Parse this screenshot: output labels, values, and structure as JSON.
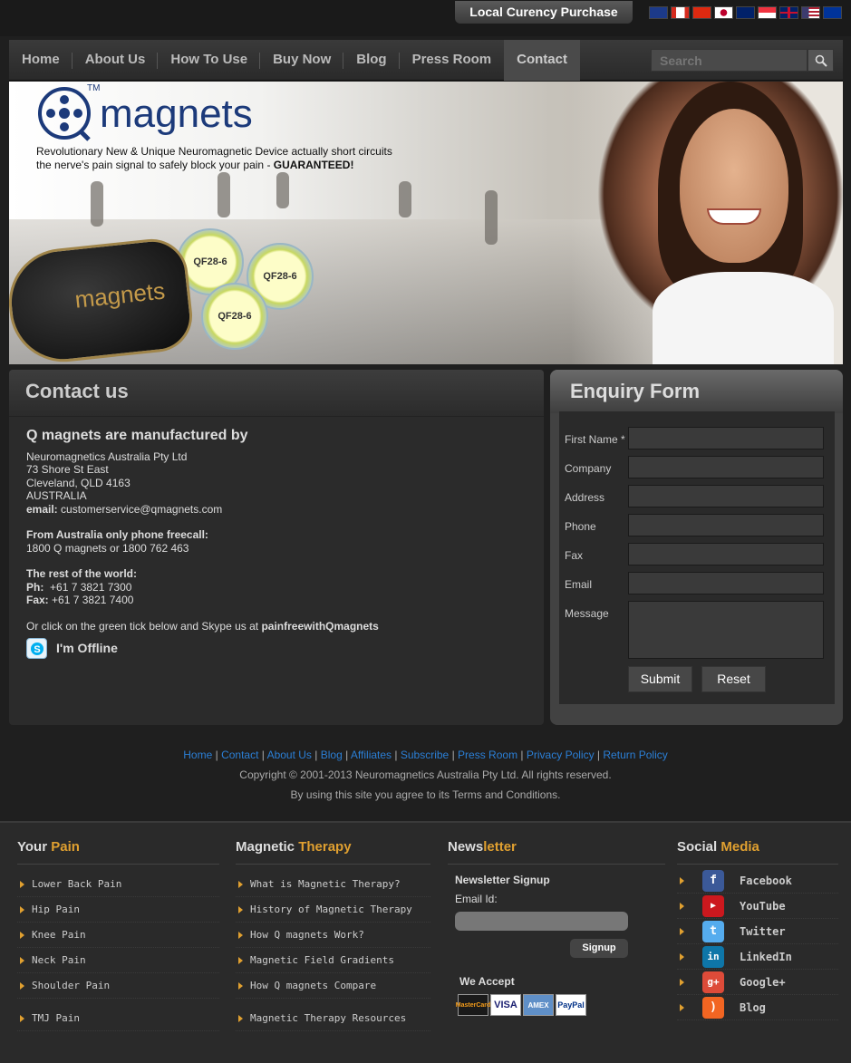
{
  "topbar": {
    "currency_label": "Local Curency Purchase",
    "flags": [
      {
        "name": "australia-flag-icon",
        "color": "#1c3a8a"
      },
      {
        "name": "canada-flag-icon",
        "color": "#d52b1e"
      },
      {
        "name": "hong-kong-flag-icon",
        "color": "#de2910"
      },
      {
        "name": "japan-flag-icon",
        "color": "#ffffff"
      },
      {
        "name": "new-zealand-flag-icon",
        "color": "#012169"
      },
      {
        "name": "singapore-flag-icon",
        "color": "#ef3340"
      },
      {
        "name": "uk-flag-icon",
        "color": "#012169"
      },
      {
        "name": "usa-flag-icon",
        "color": "#3c3b6e"
      },
      {
        "name": "eu-flag-icon",
        "color": "#003399"
      }
    ]
  },
  "nav": {
    "items": [
      "Home",
      "About Us",
      "How To Use",
      "Buy Now",
      "Blog",
      "Press Room",
      "Contact"
    ],
    "active": "Contact",
    "search_placeholder": "Search"
  },
  "hero": {
    "logo_text": "magnets",
    "tm": "TM",
    "tagline_line1": "Revolutionary New & Unique Neuromagnetic Device actually short circuits",
    "tagline_line2": "the nerve's pain signal to safely block your pain - ",
    "tagline_bold": "GUARANTEED!",
    "case_text": "magnets",
    "disc_label": "QF28-6"
  },
  "contact": {
    "title": "Contact us",
    "heading": "Q magnets are manufactured by",
    "company": "Neuromagnetics Australia Pty Ltd",
    "street": "73 Shore St East",
    "city": "Cleveland, QLD 4163",
    "country": "AUSTRALIA",
    "email_label": "email:",
    "email": " customerservice@qmagnets.com",
    "freecall_label": "From Australia only phone freecall:",
    "freecall": "1800 Q magnets or 1800 762 463",
    "world_label": "The rest of the world:",
    "ph_label": "Ph:",
    "ph": "  +61 7 3821 7300",
    "fax_label": "Fax:",
    "fax": " +61 7 3821 7400",
    "skype_note": "Or click on the green tick below and Skype us at ",
    "skype_user": "painfreewithQmagnets",
    "skype_status": "I'm Offline"
  },
  "enquiry": {
    "title": "Enquiry Form",
    "fields": [
      "First Name *",
      "Company",
      "Address",
      "Phone",
      "Fax",
      "Email",
      "Message"
    ],
    "submit": "Submit",
    "reset": "Reset"
  },
  "footer": {
    "links": [
      "Home",
      "Contact",
      "About Us",
      "Blog",
      "Affiliates",
      "Subscribe",
      "Press Room",
      "Privacy Policy",
      "Return Policy"
    ],
    "copyright": "Copyright © 2001-2013 Neuromagnetics Australia Pty Ltd. All rights reserved.",
    "terms": "By using this site you agree to its Terms and Conditions."
  },
  "bottom": {
    "pain": {
      "title_a": "Your ",
      "title_b": "Pain",
      "items": [
        "Lower Back Pain",
        "Hip Pain",
        "Knee Pain",
        "Neck Pain",
        "Shoulder Pain",
        "TMJ Pain"
      ]
    },
    "therapy": {
      "title_a": "Magnetic ",
      "title_b": "Therapy",
      "items": [
        "What is Magnetic Therapy?",
        "History of Magnetic Therapy",
        "How Q magnets Work?",
        "Magnetic Field Gradients",
        "How Q magnets Compare",
        "Magnetic Therapy Resources"
      ]
    },
    "newsletter": {
      "title_a": "News",
      "title_b": "letter",
      "signup_title": "Newsletter Signup",
      "email_label": "Email Id:",
      "signup_btn": "Signup",
      "we_accept": "We Accept",
      "cards": [
        "MasterCard",
        "VISA",
        "AMEX",
        "PayPal"
      ]
    },
    "social": {
      "title_a": "Social ",
      "title_b": "Media",
      "items": [
        {
          "label": "Facebook",
          "color": "#3b5998",
          "glyph": "f"
        },
        {
          "label": "YouTube",
          "color": "#cc181e",
          "glyph": "▶"
        },
        {
          "label": "Twitter",
          "color": "#55acee",
          "glyph": "t"
        },
        {
          "label": "LinkedIn",
          "color": "#0e76a8",
          "glyph": "in"
        },
        {
          "label": "Google+",
          "color": "#dd4b39",
          "glyph": "g+"
        },
        {
          "label": "Blog",
          "color": "#f26522",
          "glyph": ")"
        }
      ]
    }
  }
}
